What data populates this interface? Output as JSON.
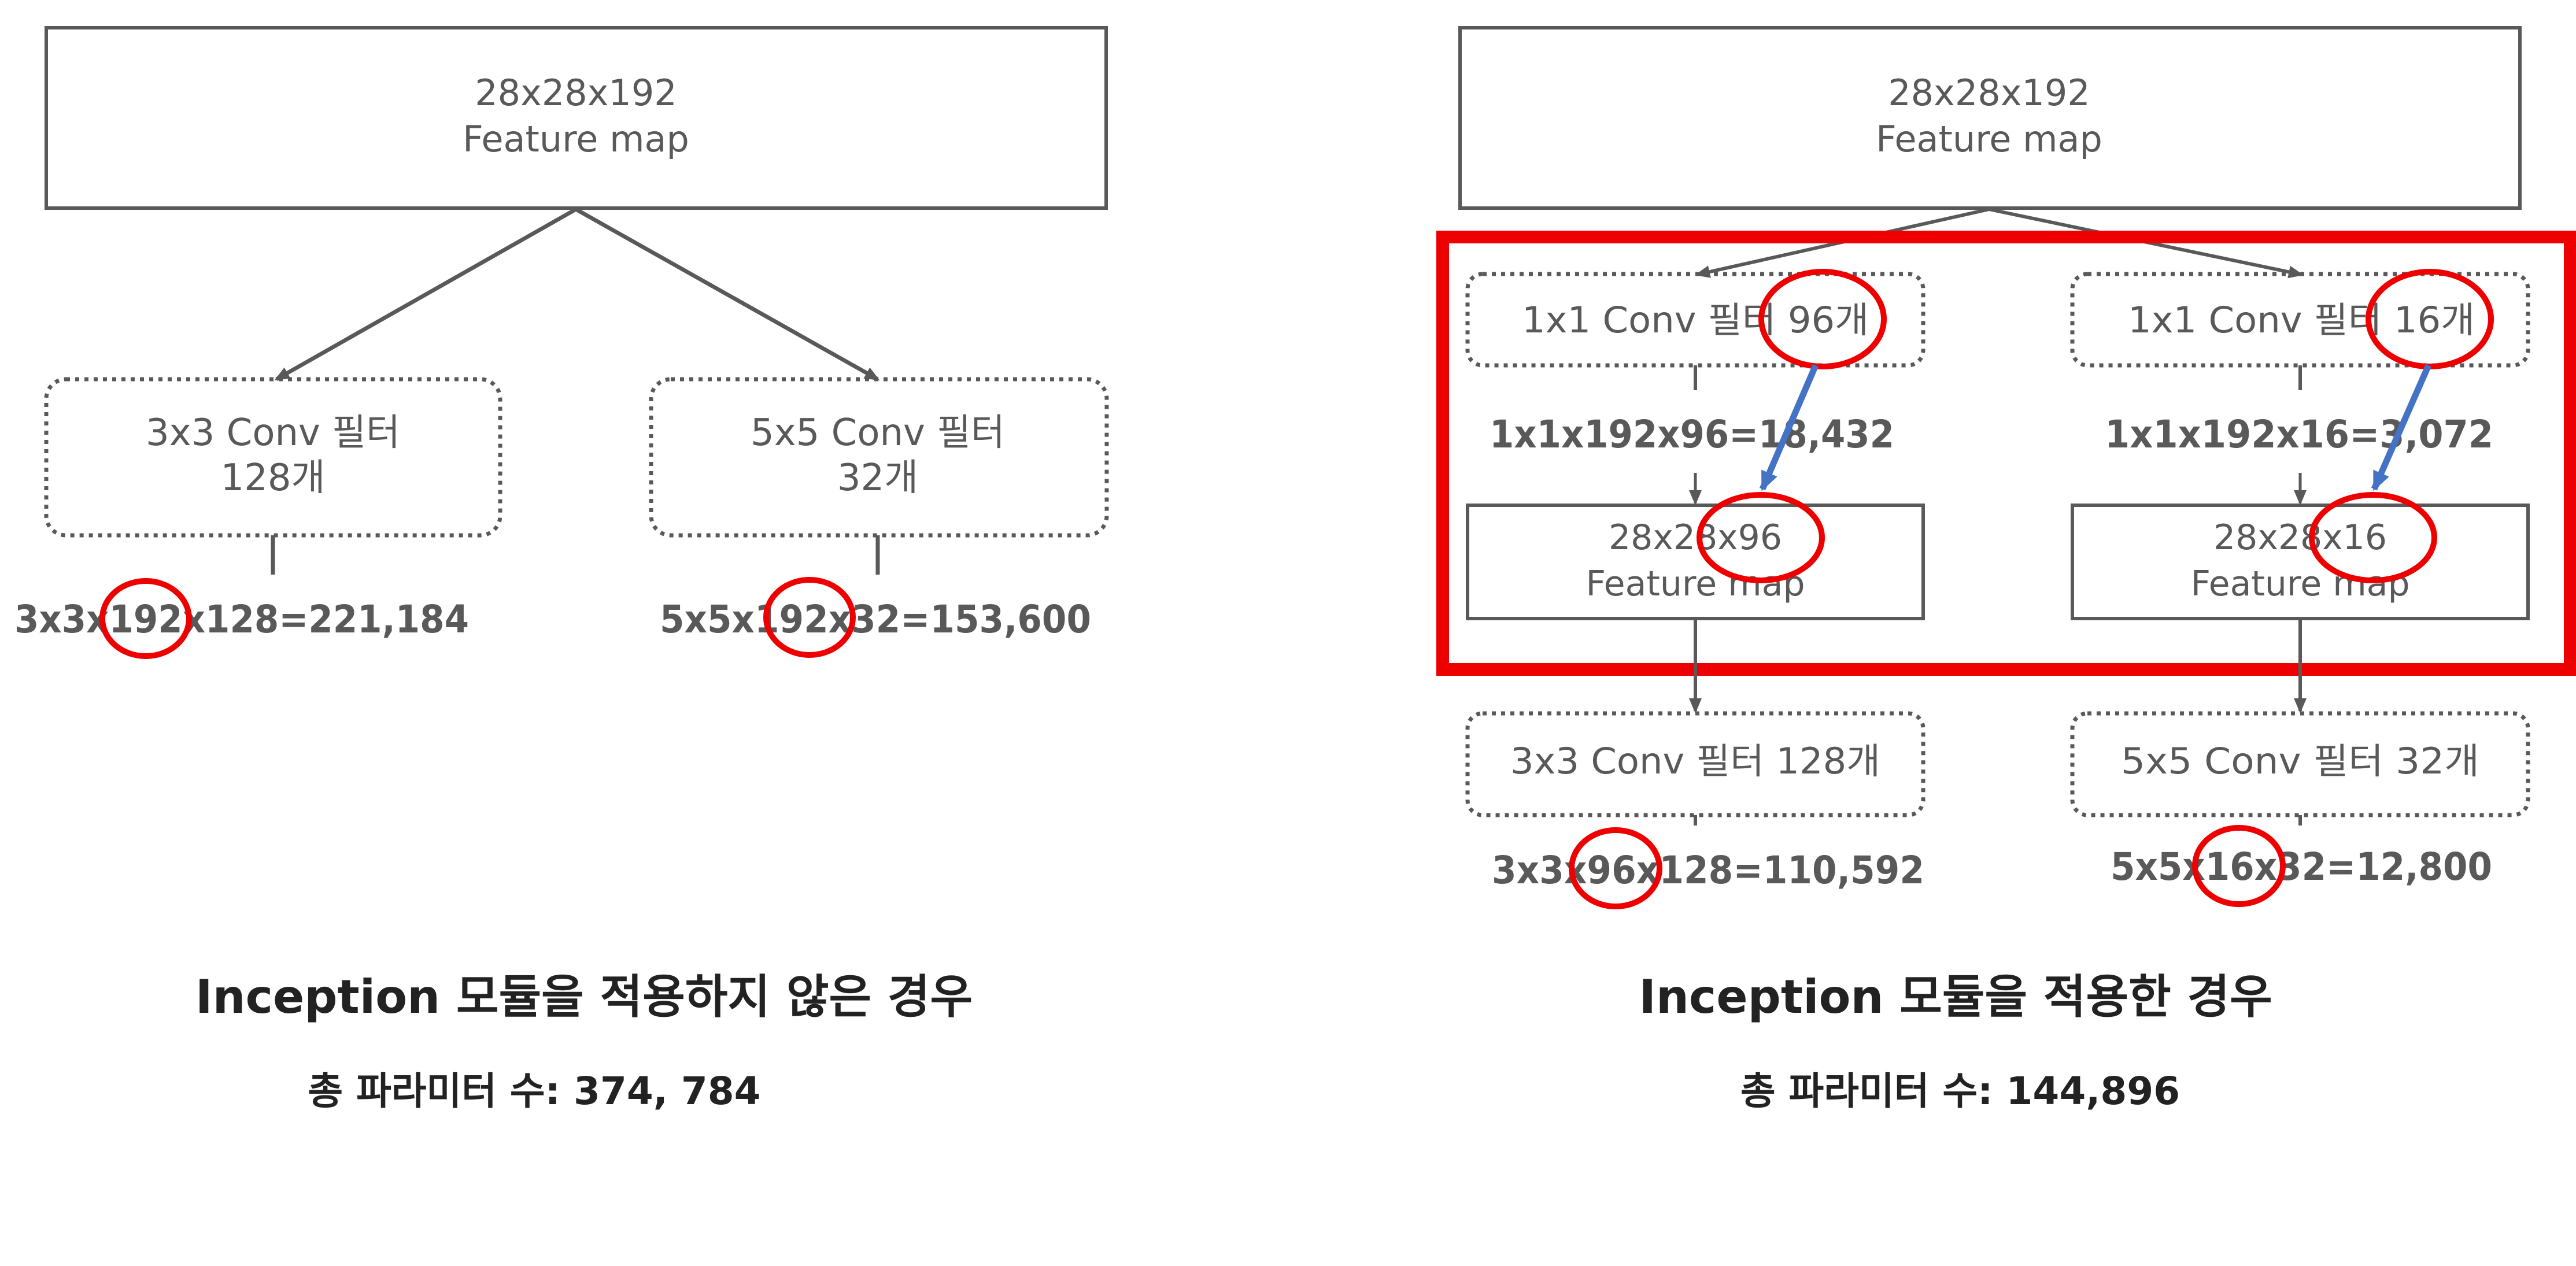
{
  "colors": {
    "box_stroke": "#595959",
    "text": "#595959",
    "heading_text": "#222222",
    "highlight_red": "#ee0000",
    "arrow_blue": "#4472c4"
  },
  "left": {
    "input": {
      "line1": "28x28x192",
      "line2": "Feature map"
    },
    "conv3": {
      "line1": "3x3 Conv 필터",
      "line2": "128개"
    },
    "conv5": {
      "line1": "5x5 Conv 필터",
      "line2": "32개"
    },
    "calc3": "3x3x192x128=221,184",
    "calc5": "5x5x192x32=153,600",
    "caption": "Inception 모듈을 적용하지 않은 경우",
    "total": "총 파라미터 수: 374, 784"
  },
  "right": {
    "input": {
      "line1": "28x28x192",
      "line2": "Feature map"
    },
    "reduce_a": "1x1 Conv 필터 96개",
    "reduce_b": "1x1 Conv 필터 16개",
    "calc_reduce_a": "1x1x192x96=18,432",
    "calc_reduce_b": "1x1x192x16=3,072",
    "fmap_a": {
      "line1": "28x28x96",
      "line2": "Feature map"
    },
    "fmap_b": {
      "line1": "28x28x16",
      "line2": "Feature map"
    },
    "conv3": "3x3 Conv 필터 128개",
    "conv5": "5x5 Conv 필터 32개",
    "calc3": "3x3x96x128=110,592",
    "calc5": "5x5x16x32=12,800",
    "caption": "Inception 모듈을 적용한 경우",
    "total": "총 파라미터 수: 144,896"
  }
}
